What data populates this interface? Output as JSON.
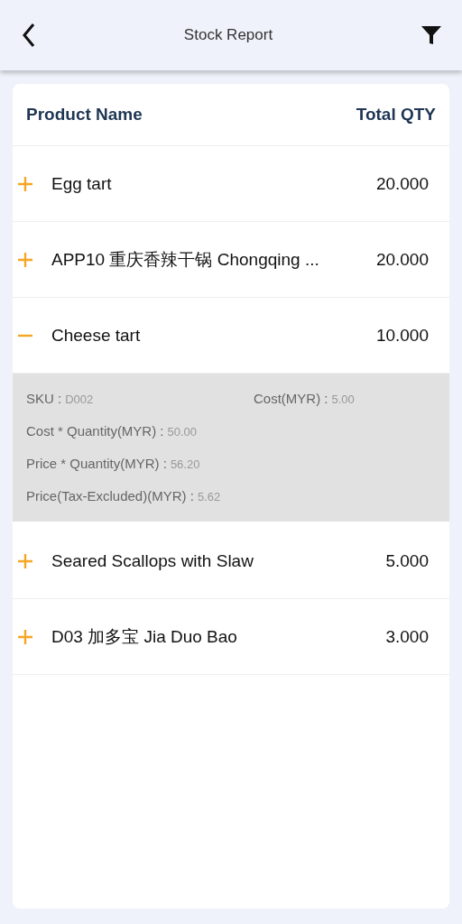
{
  "header": {
    "title": "Stock Report"
  },
  "table": {
    "columns": [
      "Product Name",
      "Total QTY"
    ],
    "rows": [
      {
        "name": "Egg tart",
        "qty": "20.000",
        "expanded": false
      },
      {
        "name": "APP10 重庆香辣干锅 Chongqing ...",
        "qty": "20.000",
        "expanded": false
      },
      {
        "name": "Cheese tart",
        "qty": "10.000",
        "expanded": true,
        "details": [
          [
            {
              "label": "SKU :",
              "value": "D002"
            },
            {
              "label": "Cost(MYR) :",
              "value": "5.00"
            }
          ],
          [
            {
              "label": "Cost * Quantity(MYR) :",
              "value": "50.00"
            }
          ],
          [
            {
              "label": "Price * Quantity(MYR) :",
              "value": "56.20"
            }
          ],
          [
            {
              "label": "Price(Tax-Excluded)(MYR) :",
              "value": "5.62"
            }
          ]
        ]
      },
      {
        "name": "Seared Scallops with Slaw",
        "qty": "5.000",
        "expanded": false
      },
      {
        "name": "D03 加多宝 Jia Duo Bao",
        "qty": "3.000",
        "expanded": false
      }
    ]
  }
}
